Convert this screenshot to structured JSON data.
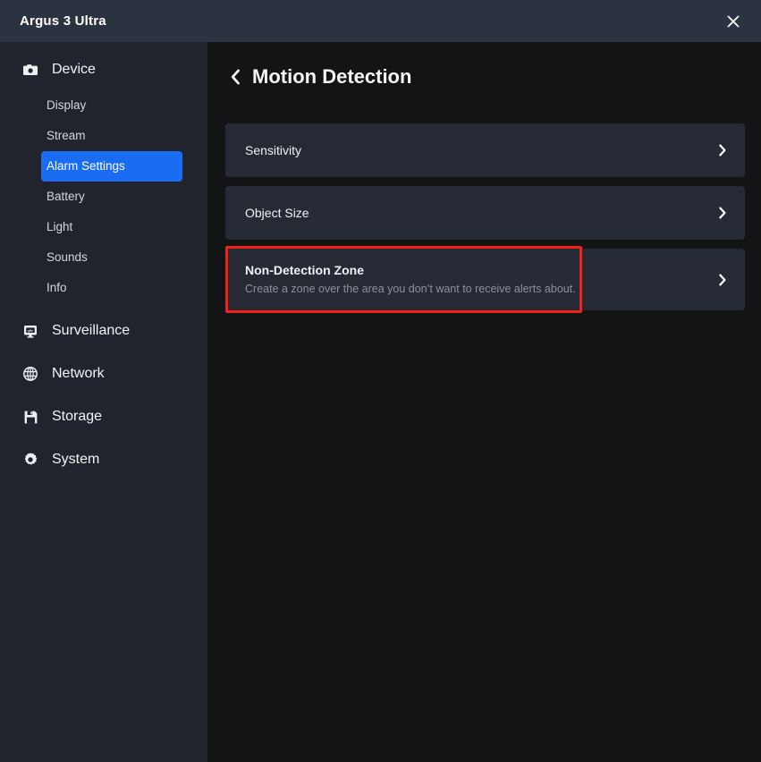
{
  "window": {
    "title": "Argus 3 Ultra",
    "close_icon": "close-icon"
  },
  "sidebar": {
    "groups": [
      {
        "label": "Device",
        "icon": "camera-icon",
        "items": [
          {
            "label": "Display",
            "active": false
          },
          {
            "label": "Stream",
            "active": false
          },
          {
            "label": "Alarm Settings",
            "active": true
          },
          {
            "label": "Battery",
            "active": false
          },
          {
            "label": "Light",
            "active": false
          },
          {
            "label": "Sounds",
            "active": false
          },
          {
            "label": "Info",
            "active": false
          }
        ]
      },
      {
        "label": "Surveillance",
        "icon": "monitor-icon",
        "items": []
      },
      {
        "label": "Network",
        "icon": "globe-icon",
        "items": []
      },
      {
        "label": "Storage",
        "icon": "floppy-disk-icon",
        "items": []
      },
      {
        "label": "System",
        "icon": "gear-icon",
        "items": []
      }
    ]
  },
  "main": {
    "back_icon": "chevron-left-icon",
    "title": "Motion Detection",
    "cards": [
      {
        "title": "Sensitivity",
        "subtitle": "",
        "chevron": "chevron-right-icon"
      },
      {
        "title": "Object Size",
        "subtitle": "",
        "chevron": "chevron-right-icon"
      },
      {
        "title": "Non-Detection Zone",
        "subtitle": "Create a zone over the area you don’t want to receive alerts about.",
        "chevron": "chevron-right-icon"
      }
    ]
  },
  "annotation": {
    "name": "highlight-box",
    "color": "#ef2118",
    "target": "Non-Detection Zone"
  },
  "colors": {
    "titlebar": "#2c3340",
    "sidebar": "#21242c",
    "content": "#131416",
    "card": "#262a35",
    "accent": "#1a6cf3",
    "annotation": "#ef2118"
  }
}
